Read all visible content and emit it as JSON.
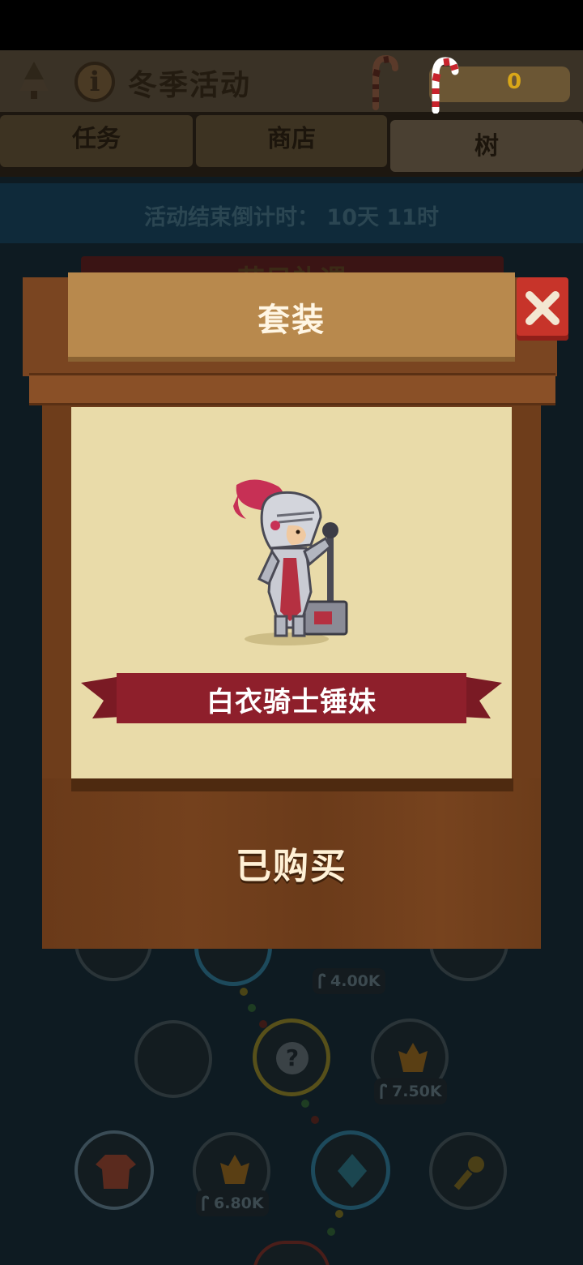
{
  "header": {
    "title": "冬季活动",
    "candy_count": "0"
  },
  "tabs": [
    {
      "label": "任务"
    },
    {
      "label": "商店"
    },
    {
      "label": "树"
    }
  ],
  "countdown": {
    "text": "活动结束倒计时： 10天 11时"
  },
  "background_banner_text": "节日礼遇",
  "tree_nodes": {
    "prices": [
      "4.00K",
      "7.50K",
      "6.80K"
    ]
  },
  "modal": {
    "title": "套装",
    "item_name": "白衣骑士锤妹",
    "status": "已购买",
    "close_icon": "close-icon"
  },
  "colors": {
    "wood_dark": "#6e3d1b",
    "title_plate": "#b8894d",
    "paper": "#e9dba9",
    "ribbon_red": "#8e1f2b",
    "close_red": "#c7342a"
  }
}
